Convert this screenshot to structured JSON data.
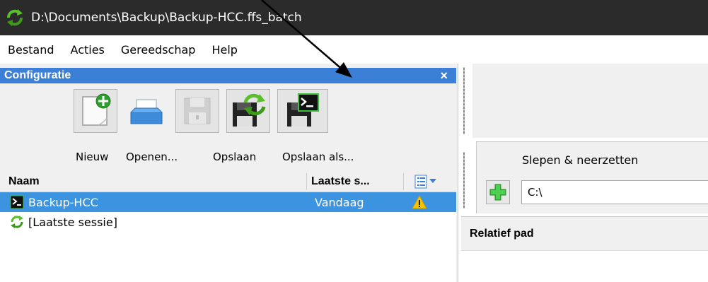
{
  "window": {
    "title": "D:\\Documents\\Backup\\Backup-HCC.ffs_batch"
  },
  "menu": [
    "Bestand",
    "Acties",
    "Gereedschap",
    "Help"
  ],
  "config_panel": {
    "title": "Configuratie",
    "close": "×",
    "toolbar": [
      {
        "label": "Nieuw",
        "icon": "new-config-icon"
      },
      {
        "label": "Openen...",
        "icon": "open-icon"
      },
      {
        "label": "Opslaan",
        "icon": "save-icon"
      },
      {
        "label": "Opslaan als...",
        "icon": "save-as-icon"
      },
      {
        "label": "save-as-batch",
        "icon": "save-as-batch-icon"
      }
    ],
    "columns": {
      "name": "Naam",
      "last_sync": "Laatste s..."
    },
    "rows": [
      {
        "name": "Backup-HCC",
        "last_sync": "Vandaag",
        "warning": true,
        "selected": true
      },
      {
        "name": "[Laatste sessie]",
        "last_sync": "",
        "warning": false,
        "selected": false
      }
    ]
  },
  "folder_pair": {
    "drag_label": "Slepen & neerzetten",
    "path_value": "C:\\"
  },
  "results": {
    "column_header": "Relatief pad"
  },
  "colors": {
    "titlebar": "#2b2b2b",
    "panel_header": "#3c7fd6",
    "selected_row": "#3c94e0"
  }
}
